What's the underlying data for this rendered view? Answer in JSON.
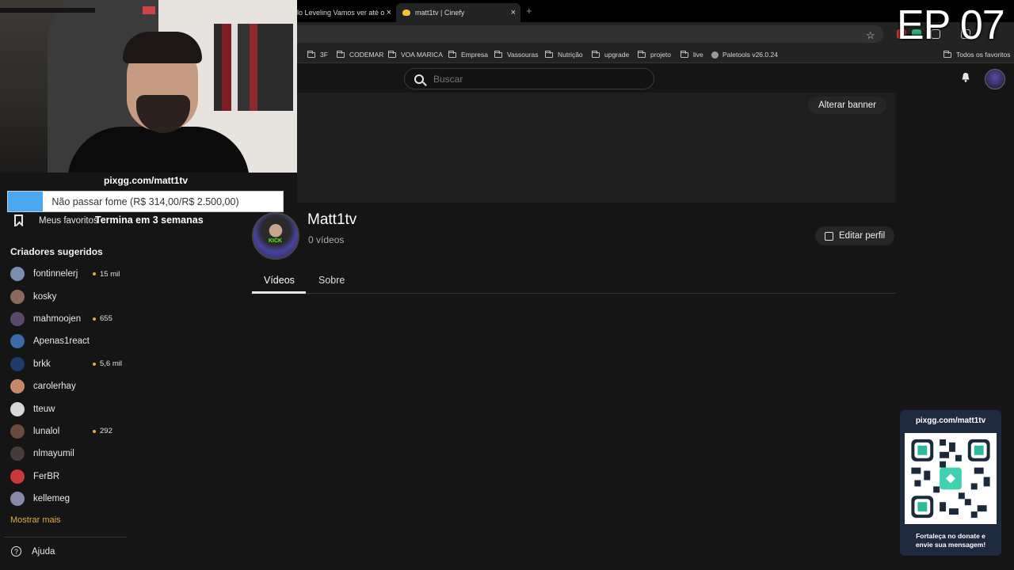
{
  "browser": {
    "tabs": [
      {
        "title": "lo Leveling Vamos ver até o",
        "close": "×"
      },
      {
        "title": "matt1tv | Cinefy",
        "close": "×"
      }
    ],
    "new_tab": "+",
    "bookmarks": [
      "3F",
      "CODEMAR",
      "VOA MARICA",
      "Empresa",
      "Vassouras",
      "Nutrição",
      "upgrade",
      "projeto",
      "live",
      "Paletools v26.0.24"
    ],
    "all_bookmarks": "Todos os favoritos"
  },
  "site": {
    "search_placeholder": "Buscar",
    "banner_button": "Alterar banner"
  },
  "overlay": {
    "donate_url": "pixgg.com/matt1tv",
    "goal_text": "Não passar fome (R$ 314,00/R$ 2.500,00)",
    "goal_progress": 0.1256,
    "goal_ends": "Termina em 3 semanas",
    "episode": "EP 07",
    "qr_url": "pixgg.com/matt1tv",
    "qr_message_1": "Fortaleça no donate e",
    "qr_message_2": "envie sua mensagem!"
  },
  "sidebar": {
    "favorites_label": "Meus favoritos",
    "suggested_title": "Criadores sugeridos",
    "creators": [
      {
        "name": "fontinnelerj",
        "viewers": "15 mil"
      },
      {
        "name": "kosky",
        "viewers": ""
      },
      {
        "name": "mahmoojen",
        "viewers": "655"
      },
      {
        "name": "Apenas1react",
        "viewers": ""
      },
      {
        "name": "brkk",
        "viewers": "5,6 mil"
      },
      {
        "name": "carolerhay",
        "viewers": ""
      },
      {
        "name": "tteuw",
        "viewers": ""
      },
      {
        "name": "lunalol",
        "viewers": "292"
      },
      {
        "name": "nlmayumil",
        "viewers": ""
      },
      {
        "name": "FerBR",
        "viewers": ""
      },
      {
        "name": "kellemeg",
        "viewers": ""
      }
    ],
    "show_more": "Mostrar mais",
    "help": "Ajuda"
  },
  "profile": {
    "name": "Matt1tv",
    "video_count": "0 vídeos",
    "edit_button": "Editar perfil",
    "avatar_badge": "KICK",
    "tabs": [
      "Vídeos",
      "Sobre"
    ]
  },
  "colors": {
    "accent": "#e8a93b",
    "goal_fill": "#4aa8f0",
    "kick_green": "#53fc18"
  }
}
